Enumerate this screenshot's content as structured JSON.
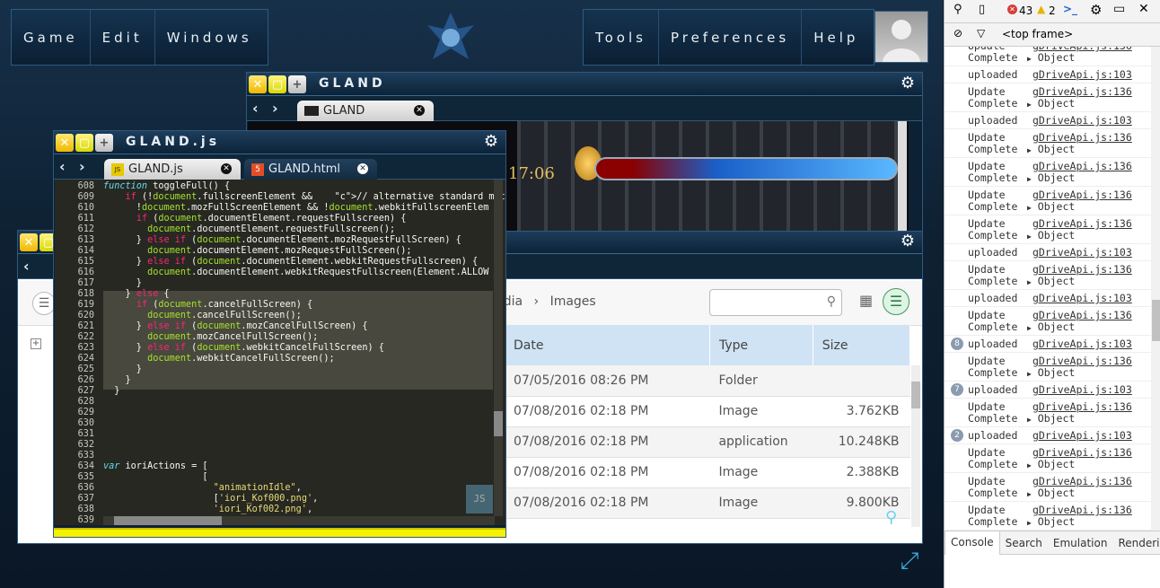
{
  "menu": {
    "left": [
      "Game",
      "Edit",
      "Windows"
    ],
    "right": [
      "Tools",
      "Preferences",
      "Help"
    ]
  },
  "game_window": {
    "title": "GLAND",
    "tab": "GLAND",
    "timer": "17:06"
  },
  "code_window": {
    "title": "GLAND.js",
    "tabs": [
      "GLAND.js",
      "GLAND.html"
    ],
    "lines": [
      {
        "n": "608",
        "t": "function toggleFull() {"
      },
      {
        "n": "609",
        "t": "    if (!document.fullscreenElement &&    // alternative standard met"
      },
      {
        "n": "610",
        "t": "      !document.mozFullScreenElement && !document.webkitFullscreenElem"
      },
      {
        "n": "611",
        "t": "      if (document.documentElement.requestFullscreen) {"
      },
      {
        "n": "612",
        "t": "        document.documentElement.requestFullscreen();"
      },
      {
        "n": "613",
        "t": "      } else if (document.documentElement.mozRequestFullScreen) {"
      },
      {
        "n": "614",
        "t": "        document.documentElement.mozRequestFullScreen();"
      },
      {
        "n": "615",
        "t": "      } else if (document.documentElement.webkitRequestFullscreen) {"
      },
      {
        "n": "616",
        "t": "        document.documentElement.webkitRequestFullscreen(Element.ALLOW"
      },
      {
        "n": "617",
        "t": "      }"
      },
      {
        "n": "618",
        "t": "    } else {"
      },
      {
        "n": "619",
        "t": "      if (document.cancelFullScreen) {"
      },
      {
        "n": "620",
        "t": "        document.cancelFullScreen();"
      },
      {
        "n": "621",
        "t": "      } else if (document.mozCancelFullScreen) {"
      },
      {
        "n": "622",
        "t": "        document.mozCancelFullScreen();"
      },
      {
        "n": "623",
        "t": "      } else if (document.webkitCancelFullScreen) {"
      },
      {
        "n": "624",
        "t": "        document.webkitCancelFullScreen();"
      },
      {
        "n": "625",
        "t": "      }"
      },
      {
        "n": "626",
        "t": "    }"
      },
      {
        "n": "627",
        "t": "  }"
      },
      {
        "n": "628",
        "t": ""
      },
      {
        "n": "629",
        "t": ""
      },
      {
        "n": "630",
        "t": ""
      },
      {
        "n": "631",
        "t": ""
      },
      {
        "n": "632",
        "t": ""
      },
      {
        "n": "633",
        "t": ""
      },
      {
        "n": "634",
        "t": "var ioriActions = ["
      },
      {
        "n": "635",
        "t": "                  ["
      },
      {
        "n": "636",
        "t": "                    \"animationIdle\","
      },
      {
        "n": "637",
        "t": "                    ['iori_Kof000.png',"
      },
      {
        "n": "638",
        "t": "                    'iori_Kof002.png',"
      },
      {
        "n": "639",
        "t": ""
      }
    ]
  },
  "file_manager": {
    "breadcrumb": [
      "Media",
      "Images"
    ],
    "columns": [
      "Date",
      "Type",
      "Size"
    ],
    "rows": [
      {
        "date": "07/05/2016 08:26 PM",
        "type": "Folder",
        "size": ""
      },
      {
        "date": "07/08/2016 02:18 PM",
        "type": "Image",
        "size": "3.762KB"
      },
      {
        "date": "07/08/2016 02:18 PM",
        "type": "application",
        "size": "10.248KB"
      },
      {
        "date": "07/08/2016 02:18 PM",
        "type": "Image",
        "size": "2.388KB"
      },
      {
        "date": "07/08/2016 02:18 PM",
        "type": "Image",
        "size": "9.800KB"
      }
    ]
  },
  "devtools": {
    "errors": "43",
    "warnings": "2",
    "frame": "<top frame>",
    "tabs": [
      "Console",
      "Search",
      "Emulation",
      "Rendering"
    ],
    "logs": [
      {
        "kind": "upd",
        "a": "Update",
        "b": "Complete",
        "link": "gDriveApi.js:136",
        "obj": "Object",
        "cut": true
      },
      {
        "kind": "up",
        "msg": "uploaded",
        "link": "gDriveApi.js:103"
      },
      {
        "kind": "upd",
        "a": "Update",
        "b": "Complete",
        "link": "gDriveApi.js:136",
        "obj": "Object"
      },
      {
        "kind": "up",
        "msg": "uploaded",
        "link": "gDriveApi.js:103"
      },
      {
        "kind": "upd",
        "a": "Update",
        "b": "Complete",
        "link": "gDriveApi.js:136",
        "obj": "Object"
      },
      {
        "kind": "upd",
        "a": "Update",
        "b": "Complete",
        "link": "gDriveApi.js:136",
        "obj": "Object"
      },
      {
        "kind": "upd",
        "a": "Update",
        "b": "Complete",
        "link": "gDriveApi.js:136",
        "obj": "Object"
      },
      {
        "kind": "upd",
        "a": "Update",
        "b": "Complete",
        "link": "gDriveApi.js:136",
        "obj": "Object"
      },
      {
        "kind": "up",
        "msg": "uploaded",
        "link": "gDriveApi.js:103"
      },
      {
        "kind": "upd",
        "a": "Update",
        "b": "Complete",
        "link": "gDriveApi.js:136",
        "obj": "Object"
      },
      {
        "kind": "up",
        "msg": "uploaded",
        "link": "gDriveApi.js:103"
      },
      {
        "kind": "upd",
        "a": "Update",
        "b": "Complete",
        "link": "gDriveApi.js:136",
        "obj": "Object"
      },
      {
        "kind": "up",
        "msg": "uploaded",
        "link": "gDriveApi.js:103",
        "badge": "8"
      },
      {
        "kind": "upd",
        "a": "Update",
        "b": "Complete",
        "link": "gDriveApi.js:136",
        "obj": "Object"
      },
      {
        "kind": "up",
        "msg": "uploaded",
        "link": "gDriveApi.js:103",
        "badge": "7"
      },
      {
        "kind": "upd",
        "a": "Update",
        "b": "Complete",
        "link": "gDriveApi.js:136",
        "obj": "Object"
      },
      {
        "kind": "up",
        "msg": "uploaded",
        "link": "gDriveApi.js:103",
        "badge": "2"
      },
      {
        "kind": "upd",
        "a": "Update",
        "b": "Complete",
        "link": "gDriveApi.js:136",
        "obj": "Object"
      },
      {
        "kind": "upd",
        "a": "Update",
        "b": "Complete",
        "link": "gDriveApi.js:136",
        "obj": "Object"
      },
      {
        "kind": "upd",
        "a": "Update",
        "b": "Complete",
        "link": "gDriveApi.js:136",
        "obj": "Object"
      }
    ]
  }
}
